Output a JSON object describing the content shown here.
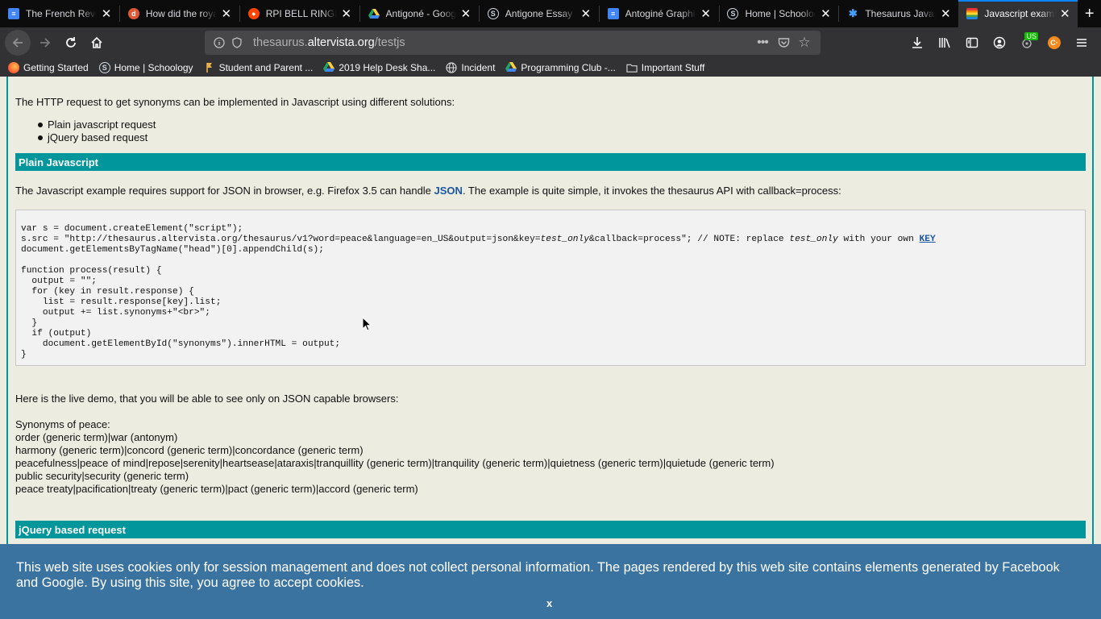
{
  "tabs": [
    {
      "title": "The French Revo",
      "icon": "docs-icon",
      "icon_color": "#4285f4",
      "active": false
    },
    {
      "title": "How did the roya",
      "icon": "duckduckgo-icon",
      "icon_color": "#de5833",
      "active": false
    },
    {
      "title": "RPI BELL RINGIN",
      "icon": "reddit-icon",
      "icon_color": "#ff4500",
      "active": false
    },
    {
      "title": "Antigoné - Goog",
      "icon": "drive-icon",
      "icon_color": "#1fa463",
      "active": false
    },
    {
      "title": "Antigone Essay 2",
      "icon": "schoology-icon",
      "icon_color": "#cfd8e3",
      "active": false
    },
    {
      "title": "Antoginé Graphic",
      "icon": "docs-icon",
      "icon_color": "#4285f4",
      "active": false
    },
    {
      "title": "Home | Schoolog",
      "icon": "schoology-icon",
      "icon_color": "#cfd8e3",
      "active": false
    },
    {
      "title": "Thesaurus Javas",
      "icon": "puzzle-icon",
      "icon_color": "#45a1ff",
      "active": false
    },
    {
      "title": "Javascript examp",
      "icon": "rainbow-icon",
      "icon_color": "#e8a33d",
      "active": true
    }
  ],
  "url": {
    "prefix": "thesaurus.",
    "domain": "altervista.org",
    "path": "/testjs"
  },
  "bookmarks": [
    {
      "label": "Getting Started",
      "icon": "firefox-icon"
    },
    {
      "label": "Home | Schoology",
      "icon": "schoology-icon"
    },
    {
      "label": "Student and Parent ...",
      "icon": "flag-icon"
    },
    {
      "label": "2019 Help Desk Sha...",
      "icon": "drive-icon"
    },
    {
      "label": "Incident",
      "icon": "globe-icon"
    },
    {
      "label": "Programming Club -...",
      "icon": "drive-icon"
    },
    {
      "label": "Important Stuff",
      "icon": "folder-icon"
    }
  ],
  "toolbar": {
    "badge": "US"
  },
  "page": {
    "intro": "The HTTP request to get synonyms can be implemented in Javascript using different solutions:",
    "bullets": [
      "Plain javascript request",
      "jQuery based request"
    ],
    "section1_title": "Plain Javascript",
    "desc_before": "The Javascript example requires support for JSON in browser, e.g. Firefox 3.5 can handle ",
    "desc_link": "JSON",
    "desc_after": ". The example is quite simple, it invokes the thesaurus API with callback=process:",
    "code": {
      "line1": "var s = document.createElement(\"script\");",
      "line2_a": "s.src = \"http://thesaurus.altervista.org/thesaurus/v1?word=peace&language=en_US&output=json&key=",
      "line2_italic": "test_only",
      "line2_b": "&callback=process\"; // NOTE: replace ",
      "line2_italic2": "test_only",
      "line2_c": " with your own ",
      "line2_key": "KEY",
      "line3": "document.getElementsByTagName(\"head\")[0].appendChild(s);",
      "line4": "",
      "line5": "function process(result) {",
      "line6": "  output = \"\";",
      "line7": "  for (key in result.response) {",
      "line8": "    list = result.response[key].list;",
      "line9": "    output += list.synonyms+\"<br>\";",
      "line10": "  }",
      "line11": "  if (output)",
      "line12": "    document.getElementById(\"synonyms\").innerHTML = output;",
      "line13": "}"
    },
    "live_demo": "Here is the live demo, that you will be able to see only on JSON capable browsers:",
    "synonyms_title": "Synonyms of peace:",
    "synonyms": [
      "order (generic term)|war (antonym)",
      "harmony (generic term)|concord (generic term)|concordance (generic term)",
      "peacefulness|peace of mind|repose|serenity|heartsease|ataraxis|tranquillity (generic term)|tranquility (generic term)|quietness (generic term)|quietude (generic term)",
      "public security|security (generic term)",
      "peace treaty|pacification|treaty (generic term)|pact (generic term)|accord (generic term)"
    ],
    "section2_title": "jQuery based request"
  },
  "cookie": {
    "text": "This web site uses cookies only for session management and does not collect personal information. The pages rendered by this web site contains elements generated by Facebook and Google. By using this site, you agree to accept cookies.",
    "close": "x"
  }
}
